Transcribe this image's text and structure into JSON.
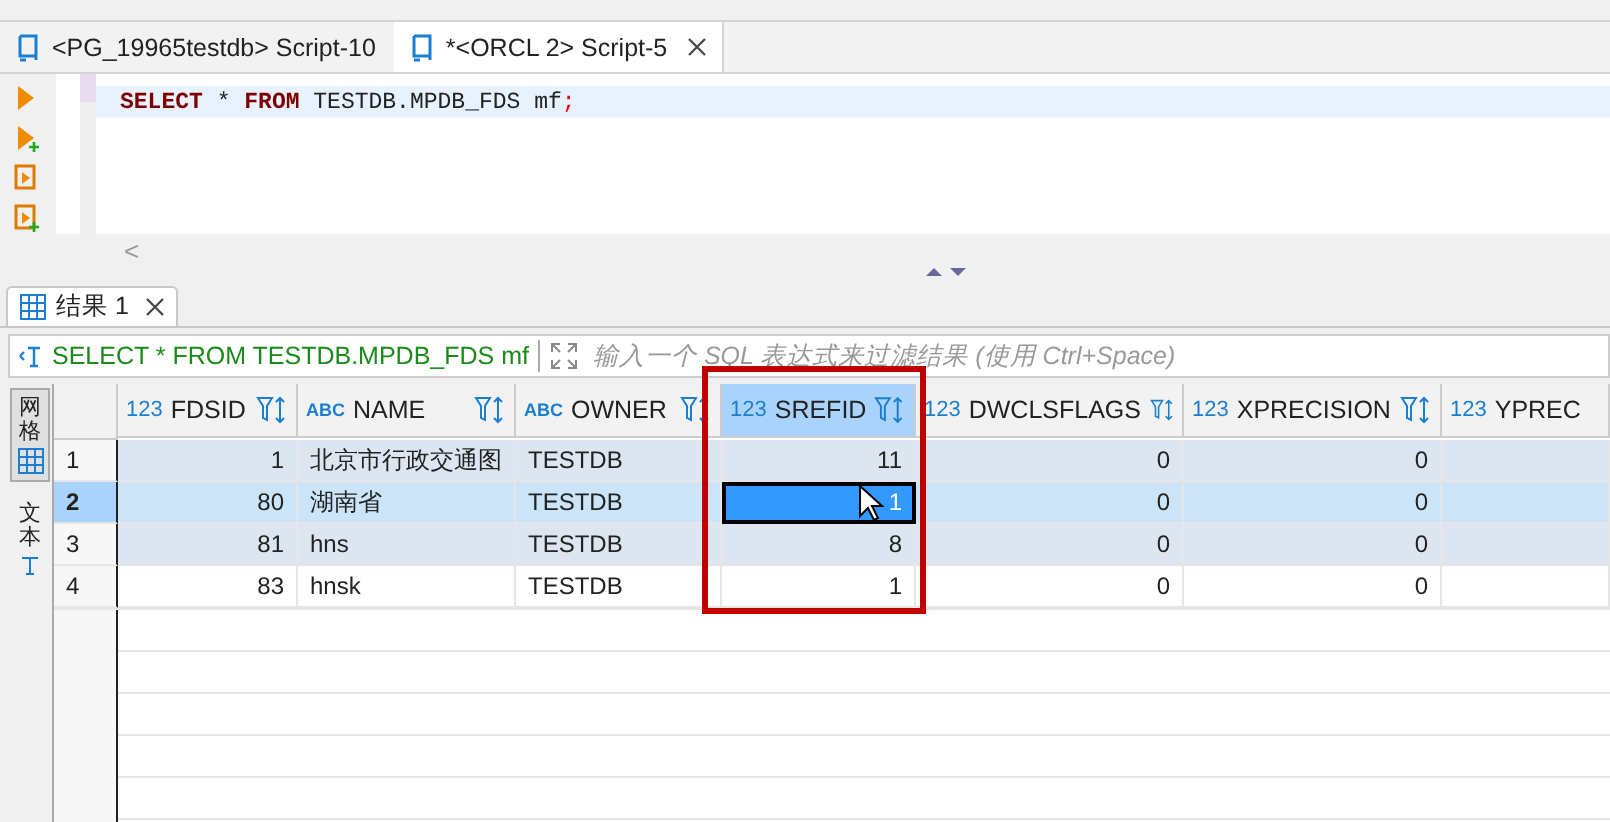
{
  "editor_tabs": [
    {
      "label": "<PG_19965testdb> Script-10",
      "selected": false,
      "closable": false
    },
    {
      "label": "*<ORCL 2> Script-5",
      "selected": true,
      "closable": true
    }
  ],
  "editor": {
    "lines": [
      "SELECT * FROM TESTDB.MPDB_FDS mf;"
    ],
    "scroll_left": "<"
  },
  "result_tabs": [
    {
      "label": "结果 1",
      "selected": true,
      "closable": true
    }
  ],
  "filter": {
    "query": "SELECT * FROM TESTDB.MPDB_FDS mf",
    "placeholder": "输入一个 SQL 表达式来过滤结果 (使用 Ctrl+Space)"
  },
  "side_tabs": [
    {
      "label": "网格",
      "selected": true
    },
    {
      "label": "文本",
      "selected": false
    }
  ],
  "table": {
    "columns": [
      {
        "name": "FDSID",
        "type_label": "123",
        "kind": "number",
        "highlighted": false
      },
      {
        "name": "NAME",
        "type_label": "ABC",
        "kind": "text",
        "highlighted": false
      },
      {
        "name": "OWNER",
        "type_label": "ABC",
        "kind": "text",
        "highlighted": false
      },
      {
        "name": "SREFID",
        "type_label": "123",
        "kind": "number",
        "highlighted": true
      },
      {
        "name": "DWCLSFLAGS",
        "type_label": "123",
        "kind": "number",
        "highlighted": false
      },
      {
        "name": "XPRECISION",
        "type_label": "123",
        "kind": "number",
        "highlighted": false
      },
      {
        "name": "YPREC",
        "type_label": "123",
        "kind": "number",
        "highlighted": false
      }
    ],
    "rows": [
      {
        "number": "1",
        "selected": false,
        "cells": [
          {
            "text": "1",
            "focused": false
          },
          {
            "text": "北京市行政交通图",
            "focused": false
          },
          {
            "text": "TESTDB",
            "focused": false
          },
          {
            "text": "11",
            "focused": false
          },
          {
            "text": "0",
            "focused": false
          },
          {
            "text": "0",
            "focused": false
          }
        ]
      },
      {
        "number": "2",
        "selected": true,
        "cells": [
          {
            "text": "80",
            "focused": false
          },
          {
            "text": "湖南省",
            "focused": false
          },
          {
            "text": "TESTDB",
            "focused": false
          },
          {
            "text": "1",
            "focused": true
          },
          {
            "text": "0",
            "focused": false
          },
          {
            "text": "0",
            "focused": false
          }
        ]
      },
      {
        "number": "3",
        "selected": false,
        "cells": [
          {
            "text": "81",
            "focused": false
          },
          {
            "text": "hns",
            "focused": false
          },
          {
            "text": "TESTDB",
            "focused": false
          },
          {
            "text": "8",
            "focused": false
          },
          {
            "text": "0",
            "focused": false
          },
          {
            "text": "0",
            "focused": false
          }
        ]
      },
      {
        "number": "4",
        "selected": false,
        "cells": [
          {
            "text": "83",
            "focused": false
          },
          {
            "text": "hnsk",
            "focused": false
          },
          {
            "text": "TESTDB",
            "focused": false
          },
          {
            "text": "1",
            "focused": false
          },
          {
            "text": "0",
            "focused": false
          },
          {
            "text": "0",
            "focused": false
          }
        ]
      }
    ]
  }
}
